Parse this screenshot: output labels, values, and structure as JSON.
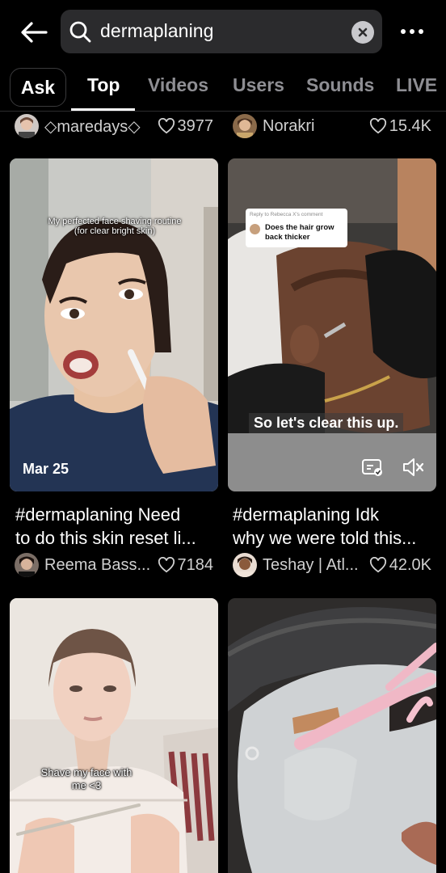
{
  "search": {
    "query": "dermaplaning"
  },
  "tabs": [
    {
      "label": "Ask"
    },
    {
      "label": "Top"
    },
    {
      "label": "Videos"
    },
    {
      "label": "Users"
    },
    {
      "label": "Sounds"
    },
    {
      "label": "LIVE"
    }
  ],
  "top_row": [
    {
      "author": "◇maredays◇",
      "likes": "3977"
    },
    {
      "author": "Norakri",
      "likes": "15.4K"
    }
  ],
  "cards": [
    {
      "overlay": "My perfected face shaving routine\n(for clear bright skin)",
      "date": "Mar 25",
      "caption": "#dermaplaning  Need\nto do this skin reset li...",
      "author": "Reema Bass...",
      "likes": "7184"
    },
    {
      "reply_header": "Reply to Rebecca X's comment",
      "reply_text": "Does the hair grow\nback thicker",
      "subtitle": "So let's clear this up.",
      "caption": "#dermaplaning  Idk\nwhy we were told this...",
      "author": "Teshay | Atl...",
      "likes": "42.0K"
    },
    {
      "overlay": "Shave my face\nwith me <3"
    },
    {}
  ],
  "colors": {
    "background": "#000000",
    "search_bg": "#2b2b2d",
    "inactive_tab": "#8e8e93"
  },
  "icons": [
    "back-arrow-icon",
    "search-icon",
    "clear-icon",
    "more-icon",
    "heart-icon",
    "captions-icon",
    "mute-icon"
  ]
}
